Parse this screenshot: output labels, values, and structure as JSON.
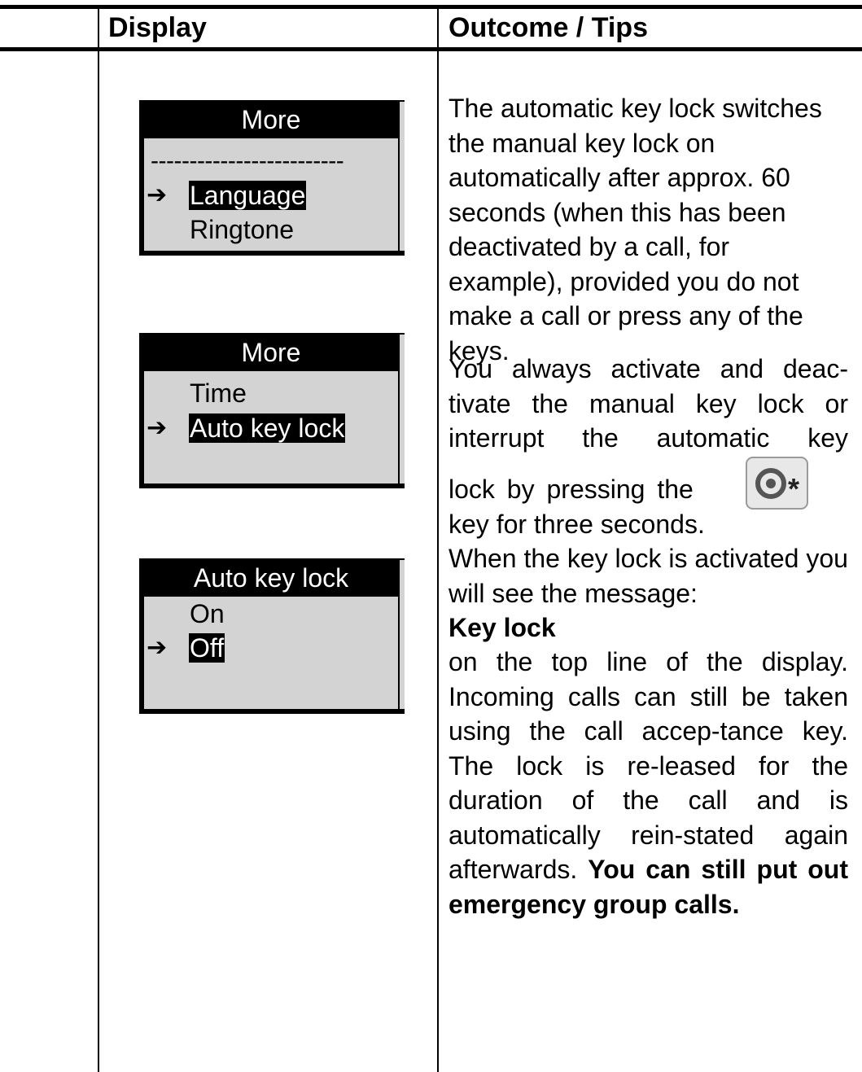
{
  "header": {
    "display": "Display",
    "outcome": "Outcome / Tips"
  },
  "screens": [
    {
      "title": "More",
      "separator": "-------------------------",
      "items": [
        {
          "label": "Language",
          "selected": true
        },
        {
          "label": "Ringtone",
          "selected": false
        }
      ]
    },
    {
      "title": "More",
      "items": [
        {
          "label": "Time",
          "selected": false
        },
        {
          "label": "Auto key lock",
          "selected": true
        }
      ]
    },
    {
      "title": "Auto key lock",
      "items": [
        {
          "label": "On",
          "selected": false
        },
        {
          "label": "Off",
          "selected": true
        }
      ]
    }
  ],
  "arrow_glyph": "➔",
  "text": {
    "p1": "The automatic key lock switches the manual key lock on automatically after approx. 60 seconds (when this has been deactivated by a call, for example), provided you do not make a call or press any of the keys.",
    "p2": "You always activate and deac-tivate the manual key lock or interrupt the automatic key",
    "p3a": "lock by pressing the",
    "p3b": "key for three seconds.",
    "p4": "When the key lock is activated you will see the message:",
    "p5": "Key lock",
    "p6": "on the top line of the display. Incoming calls can still be taken using the call accep-tance key. The lock is re-leased for the duration of the call and is automatically rein-stated again afterwards.",
    "p6_bold": "You can still put out emergency group calls."
  },
  "key_icon": "lock-key-icon"
}
